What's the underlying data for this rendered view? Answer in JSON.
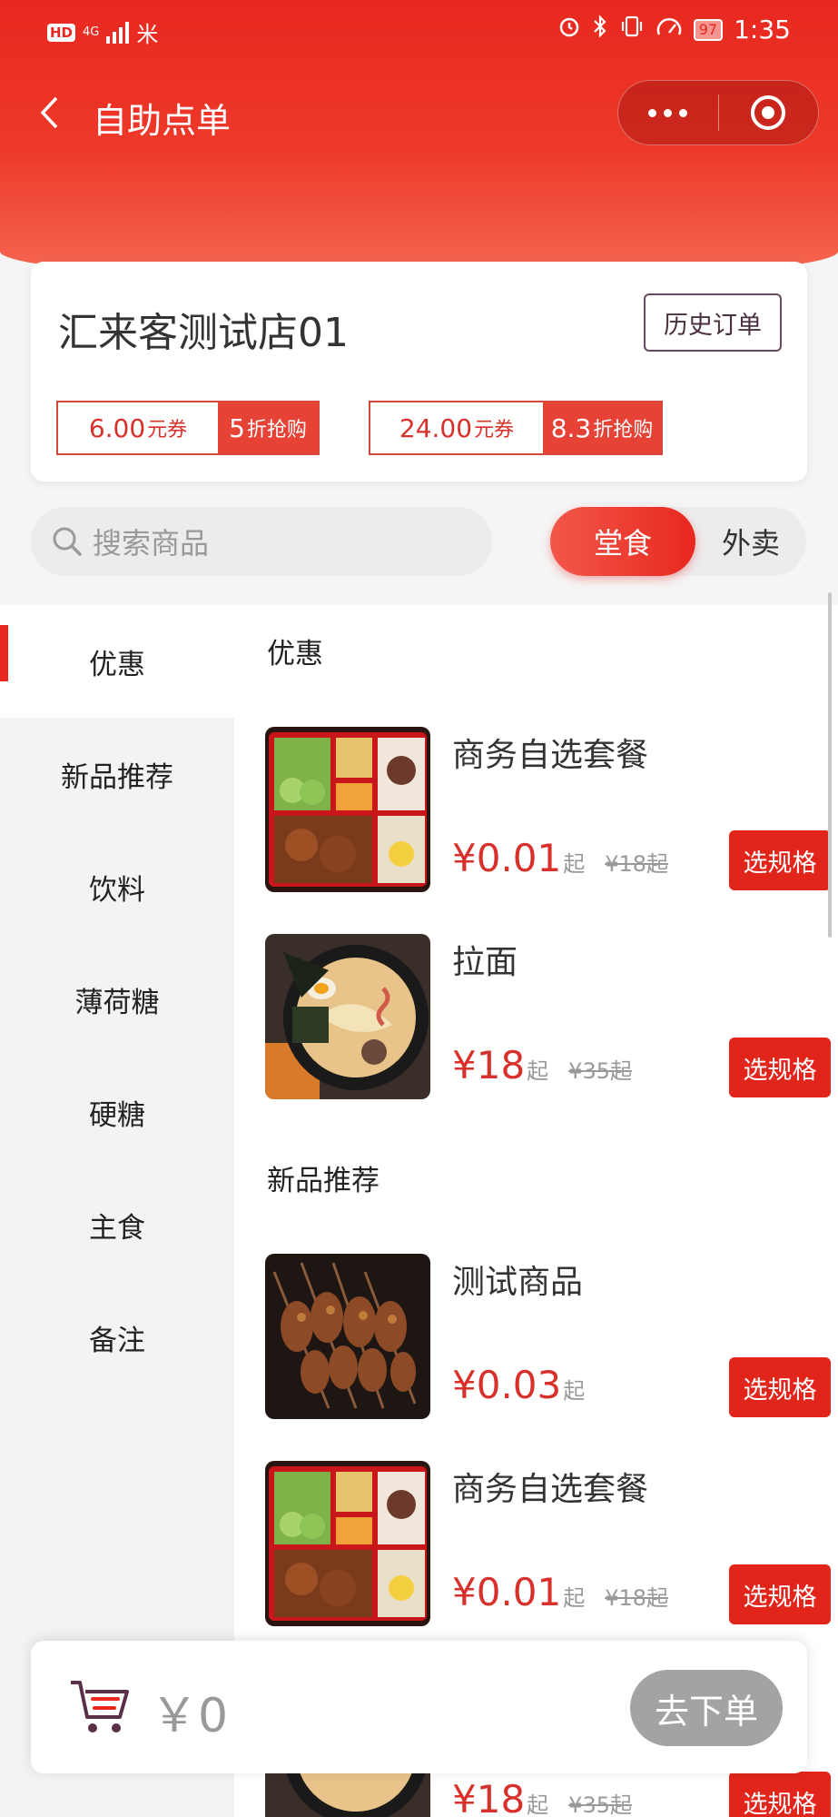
{
  "status_bar": {
    "network": "4G",
    "carrier": "米",
    "battery": "97",
    "time": "1:35"
  },
  "navbar": {
    "title": "自助点单"
  },
  "store": {
    "name": "汇来客测试店01",
    "history_label": "历史订单",
    "coupons": [
      {
        "amount": "6.00",
        "unit": "元券",
        "discount": "5",
        "discount_suffix": "折抢购"
      },
      {
        "amount": "24.00",
        "unit": "元券",
        "discount": "8.3",
        "discount_suffix": "折抢购"
      }
    ]
  },
  "search": {
    "placeholder": "搜索商品"
  },
  "mode_toggle": {
    "dine_in": "堂食",
    "takeout": "外卖",
    "selected": "堂食"
  },
  "sidebar": {
    "items": [
      {
        "label": "优惠",
        "active": true
      },
      {
        "label": "新品推荐"
      },
      {
        "label": "饮料"
      },
      {
        "label": "薄荷糖"
      },
      {
        "label": "硬糖"
      },
      {
        "label": "主食"
      },
      {
        "label": "备注"
      }
    ]
  },
  "sections": [
    {
      "title": "优惠",
      "products": [
        {
          "name": "商务自选套餐",
          "price": "¥0.01",
          "price_suffix": "起",
          "original": "¥18起",
          "button": "选规格",
          "image": "bento"
        },
        {
          "name": "拉面",
          "price": "¥18",
          "price_suffix": "起",
          "original": "¥35起",
          "button": "选规格",
          "image": "ramen"
        }
      ]
    },
    {
      "title": "新品推荐",
      "products": [
        {
          "name": "测试商品",
          "price": "¥0.03",
          "price_suffix": "起",
          "original": "",
          "button": "选规格",
          "image": "skewers"
        },
        {
          "name": "商务自选套餐",
          "price": "¥0.01",
          "price_suffix": "起",
          "original": "¥18起",
          "button": "选规格",
          "image": "bento"
        },
        {
          "name": "",
          "price": "¥18",
          "price_suffix": "起",
          "original": "¥35起",
          "button": "选规格",
          "image": "ramen"
        }
      ]
    }
  ],
  "cart": {
    "total": "￥0",
    "order_button": "去下单"
  },
  "colors": {
    "primary": "#e8281f",
    "price": "#d8302a",
    "button_disabled": "#a3a3a3"
  }
}
